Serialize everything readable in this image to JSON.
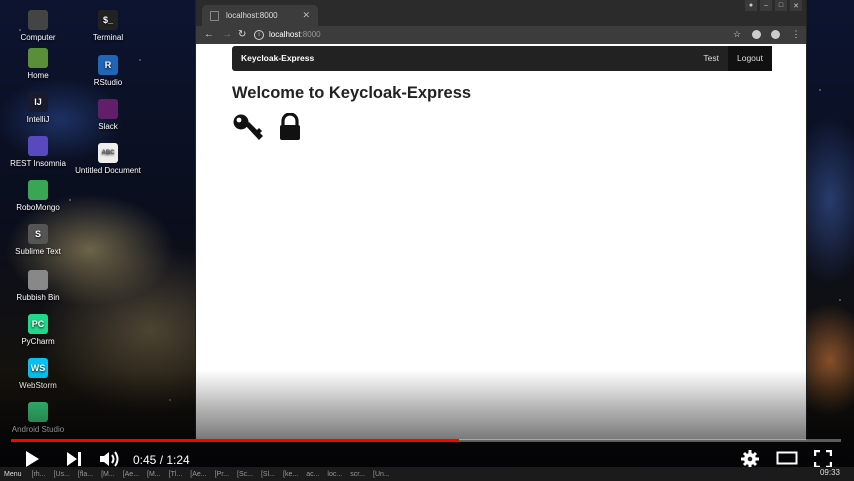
{
  "desktop": {
    "icons_col1": [
      {
        "label": "Computer",
        "icon": "computer-icon",
        "color": "#444"
      },
      {
        "label": "Home",
        "icon": "home-folder-icon",
        "color": "#5a8f3a"
      },
      {
        "label": "IntelliJ",
        "icon": "intellij-icon",
        "color": "#1a1a2e",
        "glyph": "IJ"
      },
      {
        "label": "REST Insomnia",
        "icon": "insomnia-icon",
        "color": "#5849be"
      },
      {
        "label": "RoboMongo",
        "icon": "robomongo-icon",
        "color": "#3aa655"
      },
      {
        "label": "Sublime Text",
        "icon": "sublime-text-icon",
        "color": "#555",
        "glyph": "S"
      },
      {
        "label": "Rubbish Bin",
        "icon": "trash-icon",
        "color": "#888"
      },
      {
        "label": "PyCharm",
        "icon": "pycharm-icon",
        "color": "#21d789",
        "glyph": "PC"
      },
      {
        "label": "WebStorm",
        "icon": "webstorm-icon",
        "color": "#07c3f2",
        "glyph": "WS"
      },
      {
        "label": "Android Studio",
        "icon": "android-studio-icon",
        "color": "#3ddc84"
      }
    ],
    "icons_col2": [
      {
        "label": "Terminal",
        "icon": "terminal-icon",
        "color": "#222",
        "glyph": "$_"
      },
      {
        "label": "RStudio",
        "icon": "rstudio-icon",
        "color": "#2165b6",
        "glyph": "R"
      },
      {
        "label": "Slack",
        "icon": "slack-icon",
        "color": "#611f69"
      },
      {
        "label": "Untitled Document",
        "icon": "text-document-icon",
        "color": "#eee",
        "glyph": "ABC"
      }
    ]
  },
  "browser": {
    "tab_title": "localhost:8000",
    "url_host": "localhost",
    "url_port": ":8000"
  },
  "page": {
    "brand": "Keycloak-Express",
    "nav_links": [
      "Test",
      "Logout"
    ],
    "heading": "Welcome to Keycloak-Express",
    "icons": [
      "key-icon",
      "lock-icon"
    ]
  },
  "video": {
    "time": "0:45 / 1:24",
    "progress": 0.54
  },
  "taskbar": {
    "menu": "Menu",
    "items": [
      "[rh...",
      "[Us...",
      "[fla...",
      "[M...",
      "[Ae...",
      "[M...",
      "[Tl...",
      "[Ae...",
      "[Pr...",
      "[Sc...",
      "[Sl...",
      "[ke...",
      "ac...",
      "loc...",
      "scr...",
      "[Un..."
    ],
    "clock": "09:33"
  }
}
